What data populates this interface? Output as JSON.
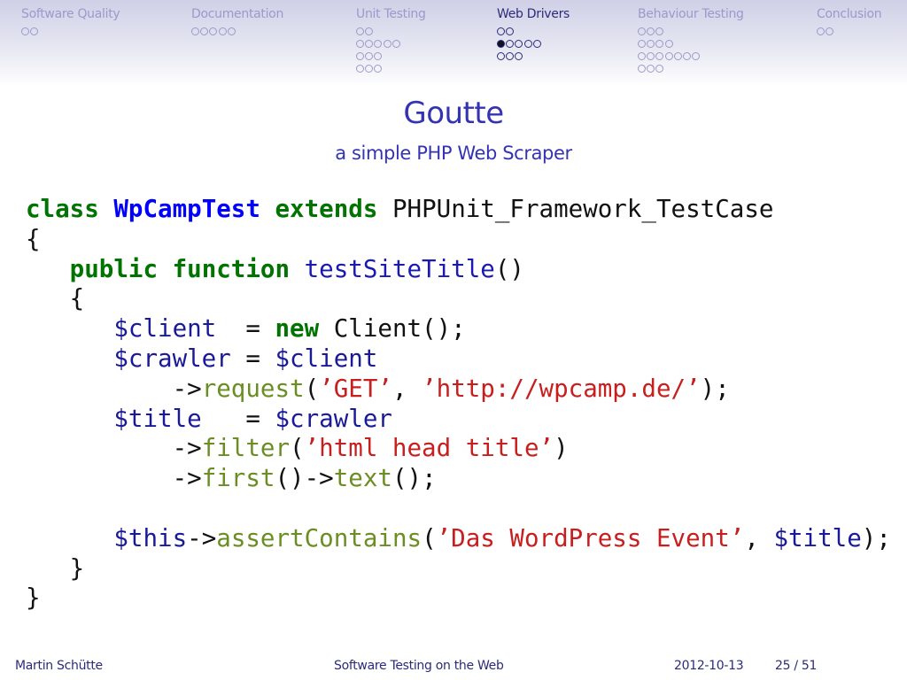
{
  "navigation": {
    "sections": [
      {
        "title": "Software Quality",
        "rows": [
          2
        ],
        "active": false
      },
      {
        "title": "Documentation",
        "rows": [
          5
        ],
        "active": false
      },
      {
        "title": "Unit Testing",
        "rows": [
          2,
          5,
          3,
          3
        ],
        "active": false
      },
      {
        "title": "Web Drivers",
        "rows": [
          2,
          5,
          3
        ],
        "active": true,
        "current_row": 2,
        "current_dot": 1
      },
      {
        "title": "Behaviour Testing",
        "rows": [
          3,
          4,
          7,
          3
        ],
        "active": false
      },
      {
        "title": "Conclusion",
        "rows": [
          2
        ],
        "active": false
      }
    ]
  },
  "frame": {
    "title": "Goutte",
    "subtitle": "a simple PHP Web Scraper"
  },
  "code": [
    [
      [
        "keyword",
        "class"
      ],
      [
        "plain",
        " "
      ],
      [
        "classname",
        "WpCampTest"
      ],
      [
        "plain",
        " "
      ],
      [
        "keyword",
        "extends"
      ],
      [
        "plain",
        " PHPUnit_Framework_TestCase"
      ]
    ],
    [
      [
        "plain",
        "{"
      ]
    ],
    [
      [
        "plain",
        "   "
      ],
      [
        "keyword",
        "public"
      ],
      [
        "plain",
        " "
      ],
      [
        "keyword",
        "function"
      ],
      [
        "plain",
        " "
      ],
      [
        "function",
        "testSiteTitle"
      ],
      [
        "plain",
        "()"
      ]
    ],
    [
      [
        "plain",
        "   {"
      ]
    ],
    [
      [
        "plain",
        "      "
      ],
      [
        "variable",
        "$client"
      ],
      [
        "plain",
        "  = "
      ],
      [
        "keyword",
        "new"
      ],
      [
        "plain",
        " Client();"
      ]
    ],
    [
      [
        "plain",
        "      "
      ],
      [
        "variable",
        "$crawler"
      ],
      [
        "plain",
        " = "
      ],
      [
        "variable",
        "$client"
      ]
    ],
    [
      [
        "plain",
        "          ->"
      ],
      [
        "method",
        "request"
      ],
      [
        "plain",
        "("
      ],
      [
        "string",
        "’GET’"
      ],
      [
        "plain",
        ", "
      ],
      [
        "string",
        "’http://wpcamp.de/’"
      ],
      [
        "plain",
        ");"
      ]
    ],
    [
      [
        "plain",
        "      "
      ],
      [
        "variable",
        "$title"
      ],
      [
        "plain",
        "   = "
      ],
      [
        "variable",
        "$crawler"
      ]
    ],
    [
      [
        "plain",
        "          ->"
      ],
      [
        "method",
        "filter"
      ],
      [
        "plain",
        "("
      ],
      [
        "string",
        "’html head title’"
      ],
      [
        "plain",
        ")"
      ]
    ],
    [
      [
        "plain",
        "          ->"
      ],
      [
        "method",
        "first"
      ],
      [
        "plain",
        "()->"
      ],
      [
        "method",
        "text"
      ],
      [
        "plain",
        "();"
      ]
    ],
    [],
    [
      [
        "plain",
        "      "
      ],
      [
        "variable",
        "$this"
      ],
      [
        "plain",
        "->"
      ],
      [
        "method",
        "assertContains"
      ],
      [
        "plain",
        "("
      ],
      [
        "string",
        "’Das WordPress Event’"
      ],
      [
        "plain",
        ", "
      ],
      [
        "variable",
        "$title"
      ],
      [
        "plain",
        ");"
      ]
    ],
    [
      [
        "plain",
        "   }"
      ]
    ],
    [
      [
        "plain",
        "}"
      ]
    ]
  ],
  "footer": {
    "author": "Martin Schütte",
    "title": "Software Testing on the Web",
    "date": "2012-10-13",
    "page": "25 / 51"
  },
  "colors": {
    "structure": "#3333b3",
    "nav_inactive": "#9a9acb",
    "nav_active": "#2b2b7a",
    "keyword": "#007300",
    "classname": "#0000ff",
    "variable": "#1a1a99",
    "method": "#6b8e23",
    "string": "#c81e1e"
  }
}
